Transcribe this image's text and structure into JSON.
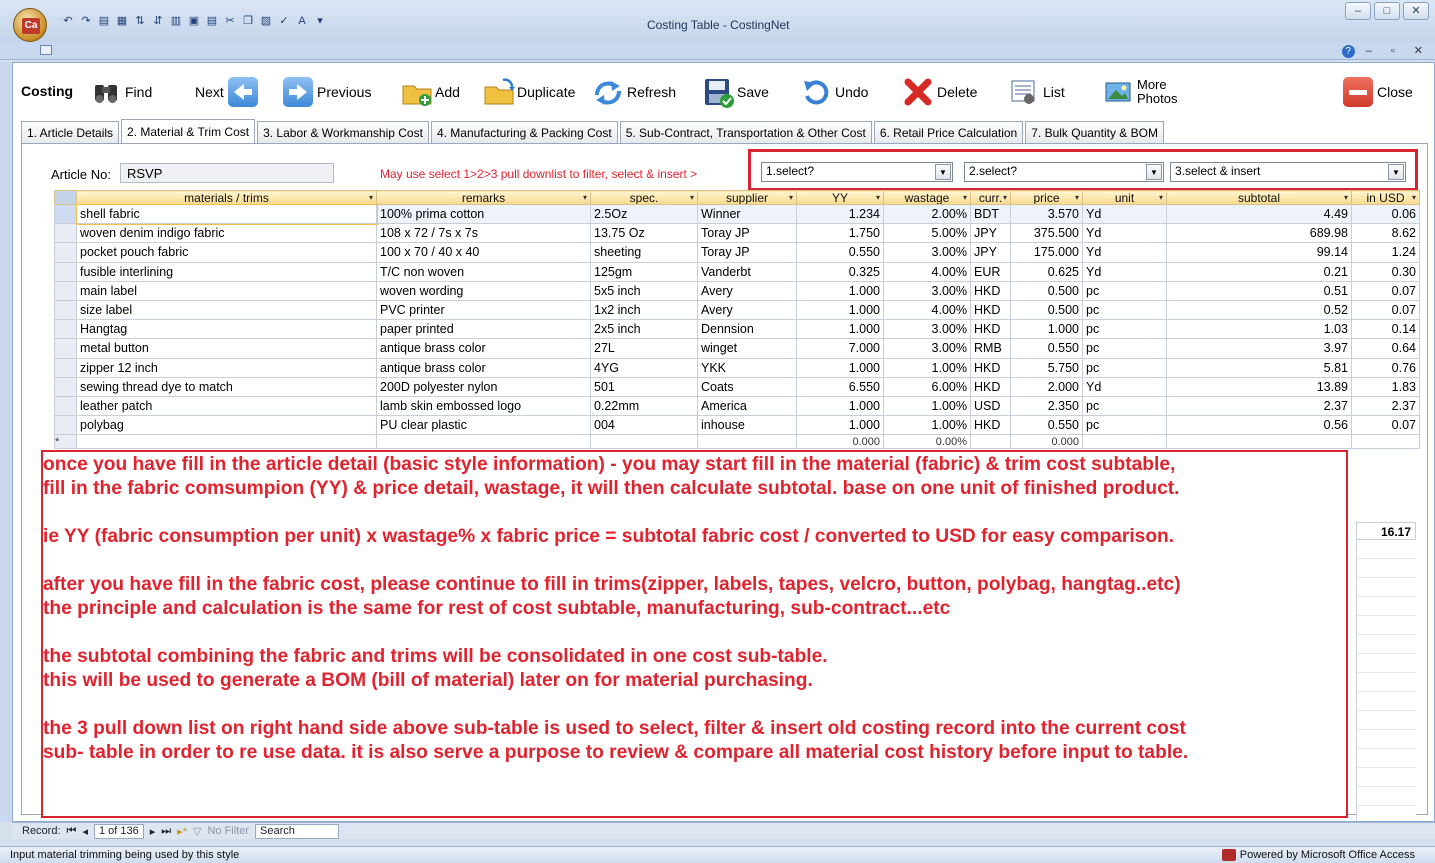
{
  "window": {
    "title": "Costing Table - CostingNet",
    "office_button_label": "Ca"
  },
  "toolbar": {
    "label": "Costing",
    "find": "Find",
    "next": "Next",
    "previous": "Previous",
    "add": "Add",
    "duplicate": "Duplicate",
    "refresh": "Refresh",
    "save": "Save",
    "undo": "Undo",
    "delete": "Delete",
    "list": "List",
    "more_photos_1": "More",
    "more_photos_2": "Photos",
    "close": "Close"
  },
  "tabs": [
    {
      "label": "1. Article Details",
      "active": false
    },
    {
      "label": "2. Material & Trim Cost",
      "active": true
    },
    {
      "label": "3. Labor & Workmanship Cost",
      "active": false
    },
    {
      "label": "4. Manufacturing & Packing Cost",
      "active": false
    },
    {
      "label": "5. Sub-Contract, Transportation & Other Cost",
      "active": false
    },
    {
      "label": "6. Retail Price Calculation",
      "active": false
    },
    {
      "label": "7. Bulk Quantity & BOM",
      "active": false
    }
  ],
  "article": {
    "label": "Article No:",
    "value": "RSVP"
  },
  "hint": "May use select 1>2>3 pull downlist to filter, select & insert >",
  "selects": {
    "s1": "1.select?",
    "s2": "2.select?",
    "s3": "3.select & insert"
  },
  "grid": {
    "columns": [
      "materials / trims",
      "remarks",
      "spec.",
      "supplier",
      "YY",
      "wastage",
      "curr.",
      "price",
      "unit",
      "subtotal",
      "in USD"
    ],
    "rows": [
      [
        "shell fabric",
        "100% prima cotton",
        "2.5Oz",
        "Winner",
        "1.234",
        "2.00%",
        "BDT",
        "3.570",
        "Yd",
        "4.49",
        "0.06"
      ],
      [
        "woven denim indigo fabric",
        "108 x 72 / 7s x 7s",
        "13.75 Oz",
        "Toray JP",
        "1.750",
        "5.00%",
        "JPY",
        "375.500",
        "Yd",
        "689.98",
        "8.62"
      ],
      [
        "pocket pouch fabric",
        "100 x 70 / 40 x 40",
        "sheeting",
        "Toray JP",
        "0.550",
        "3.00%",
        "JPY",
        "175.000",
        "Yd",
        "99.14",
        "1.24"
      ],
      [
        "fusible interlining",
        "T/C non woven",
        "125gm",
        "Vanderbt",
        "0.325",
        "4.00%",
        "EUR",
        "0.625",
        "Yd",
        "0.21",
        "0.30"
      ],
      [
        "main label",
        "woven wording",
        "5x5 inch",
        "Avery",
        "1.000",
        "3.00%",
        "HKD",
        "0.500",
        "pc",
        "0.51",
        "0.07"
      ],
      [
        "size label",
        "PVC printer",
        "1x2 inch",
        "Avery",
        "1.000",
        "4.00%",
        "HKD",
        "0.500",
        "pc",
        "0.52",
        "0.07"
      ],
      [
        "Hangtag",
        "paper printed",
        "2x5 inch",
        "Dennsion",
        "1.000",
        "3.00%",
        "HKD",
        "1.000",
        "pc",
        "1.03",
        "0.14"
      ],
      [
        "metal button",
        "antique brass color",
        "27L",
        "winget",
        "7.000",
        "3.00%",
        "RMB",
        "0.550",
        "pc",
        "3.97",
        "0.64"
      ],
      [
        "zipper 12 inch",
        "antique brass color",
        "4YG",
        "YKK",
        "1.000",
        "1.00%",
        "HKD",
        "5.750",
        "pc",
        "5.81",
        "0.76"
      ],
      [
        "sewing thread dye to match",
        "200D polyester nylon",
        "501",
        "Coats",
        "6.550",
        "6.00%",
        "HKD",
        "2.000",
        "Yd",
        "13.89",
        "1.83"
      ],
      [
        "leather patch",
        "lamb skin embossed logo",
        "0.22mm",
        "America",
        "1.000",
        "1.00%",
        "USD",
        "2.350",
        "pc",
        "2.37",
        "2.37"
      ],
      [
        "polybag",
        "PU clear plastic",
        "004",
        "inhouse",
        "1.000",
        "1.00%",
        "HKD",
        "0.550",
        "pc",
        "0.56",
        "0.07"
      ]
    ],
    "new_row": {
      "marker": "*",
      "yy": "0.000",
      "wastage": "0.00%",
      "price": "0.000"
    },
    "total_usd": "16.17"
  },
  "note": {
    "lines": [
      "once you have fill in the article detail (basic style information) - you may start fill in the material (fabric) & trim cost subtable,",
      "fill in the fabric comsumpion (YY) & price detail, wastage, it will then calculate subtotal. base on one unit of finished product.",
      "",
      "ie YY (fabric consumption per unit) x wastage% x fabric price = subtotal fabric cost / converted to USD for easy comparison.",
      "",
      "after you have fill in the fabric cost, please continue to fill in trims(zipper, labels, tapes, velcro, button, polybag, hangtag..etc)",
      "the principle and calculation is the same for rest of cost subtable, manufacturing, sub-contract...etc",
      "",
      "the subtotal combining the fabric and trims will be consolidated in one cost sub-table.",
      "this will be used to generate a BOM (bill of material) later on for material purchasing.",
      "",
      "the 3 pull down list on right hand side above sub-table is used to select, filter & insert old costing record into the current cost",
      "sub- table in order to re use data. it is also serve a purpose to review & compare all material cost history before input to table."
    ]
  },
  "navigator": {
    "label": "Record:",
    "position": "1 of 136",
    "filter": "No Filter",
    "search": "Search"
  },
  "status": {
    "text": "Input material trimming being used by this style",
    "powered": "Powered by Microsoft Office Access"
  },
  "colors": {
    "accent_red": "#e0242f",
    "header_gold": "#f7d98e"
  }
}
